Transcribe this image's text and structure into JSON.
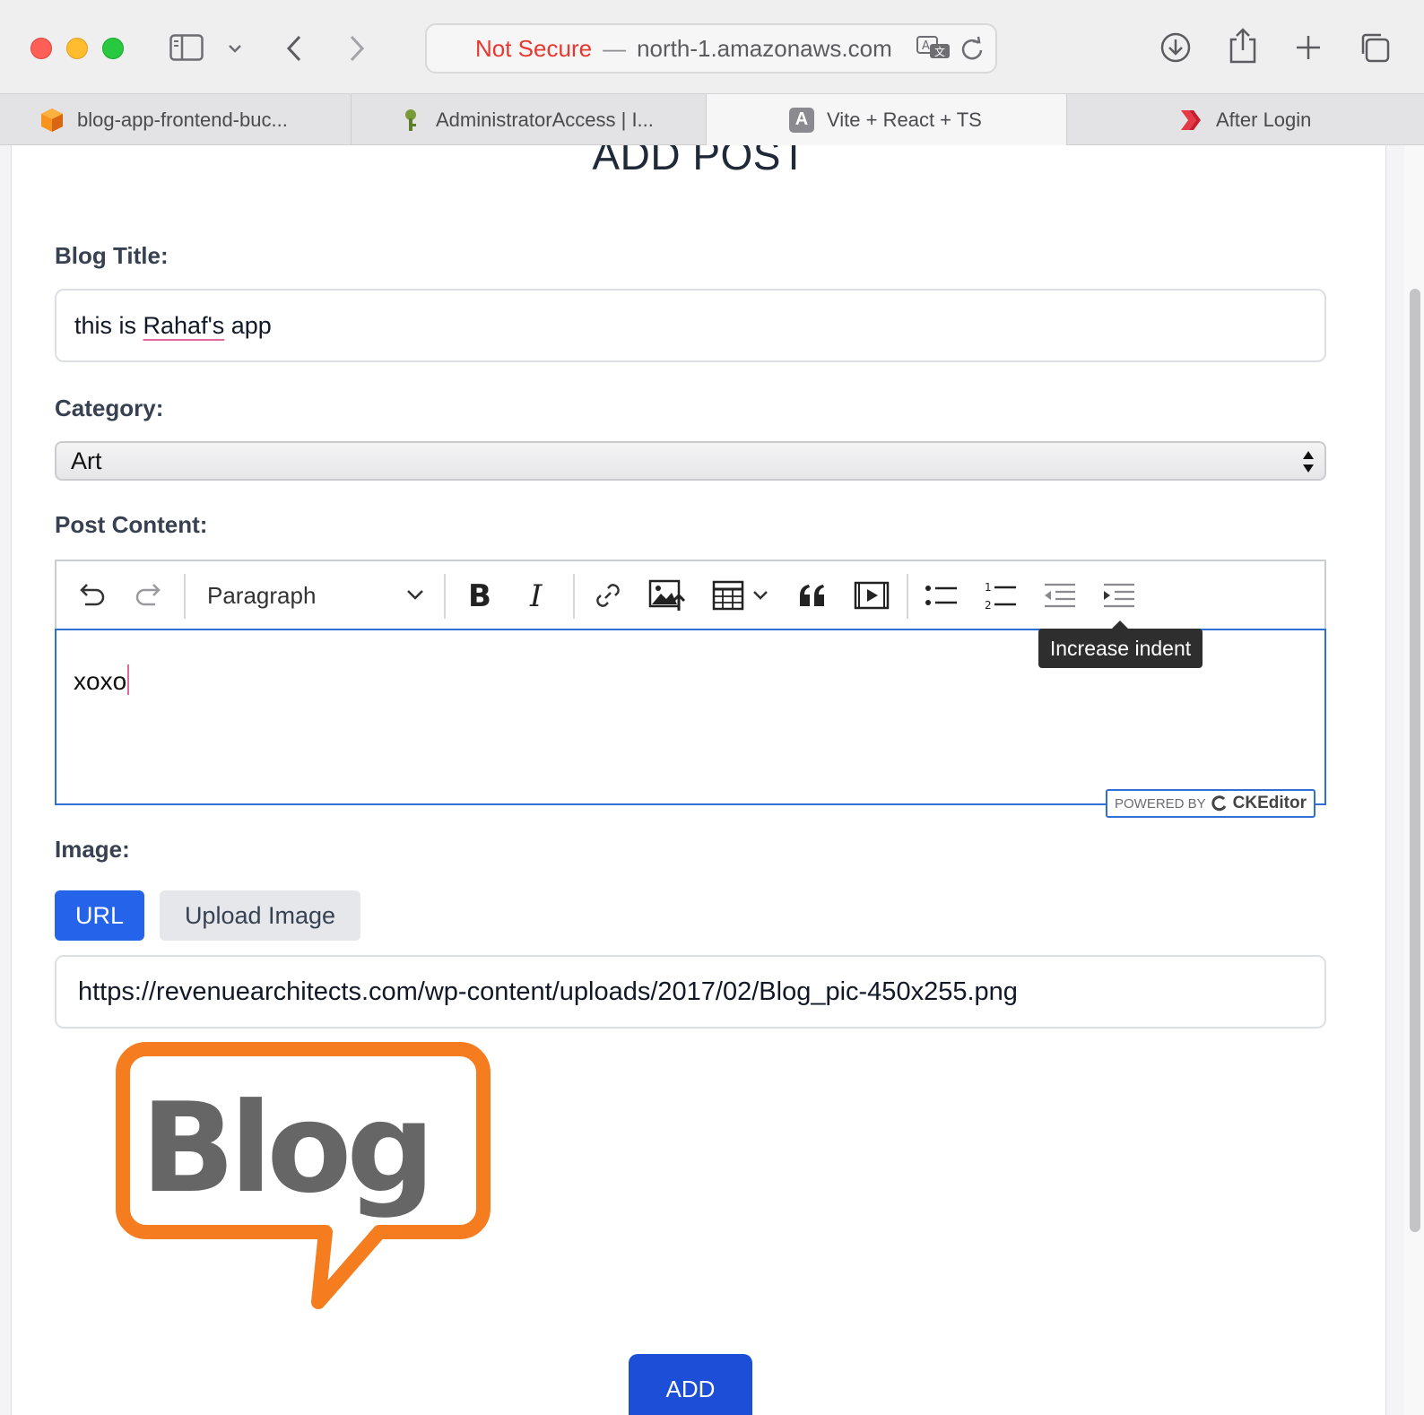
{
  "browser": {
    "address": {
      "security_label": "Not Secure",
      "separator": "—",
      "host": "north-1.amazonaws.com"
    },
    "tabs": [
      {
        "label": "blog-app-frontend-buc...",
        "icon": "aws-s3-cube-icon"
      },
      {
        "label": "AdministratorAccess | I...",
        "icon": "key-icon"
      },
      {
        "label": "Vite + React + TS",
        "icon": "letter-a-icon",
        "icon_text": "A"
      },
      {
        "label": "After Login",
        "icon": "double-chevron-icon"
      }
    ]
  },
  "page": {
    "title": "ADD POST",
    "blog_title": {
      "label": "Blog Title:",
      "value_prefix": "this is ",
      "value_misspelled": "Rahaf's",
      "value_suffix": " app"
    },
    "category": {
      "label": "Category:",
      "selected": "Art"
    },
    "post_content": {
      "label": "Post Content:",
      "heading_dropdown": "Paragraph",
      "text": "xoxo",
      "tooltip": "Increase indent",
      "powered_by": "POWERED BY",
      "powered_brand": "CKEditor"
    },
    "image": {
      "label": "Image:",
      "url_tab": "URL",
      "upload_tab": "Upload Image",
      "url_value": "https://revenuearchitects.com/wp-content/uploads/2017/02/Blog_pic-450x255.png",
      "preview_text": "Blog"
    },
    "submit_label": "ADD"
  },
  "colors": {
    "primary": "#2563eb",
    "insecure": "#e8372f",
    "editor_focus": "#2f6fd6",
    "blog_orange": "#f57c1f",
    "blog_gray": "#666666"
  }
}
